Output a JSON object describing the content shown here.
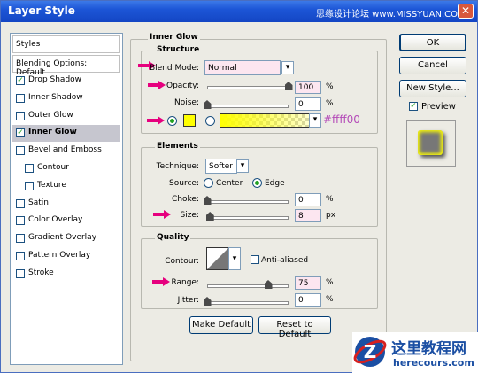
{
  "window": {
    "title": "Layer Style",
    "watermark": "思缘设计论坛 www.MISSYUAN.COM",
    "close_symbol": "✕"
  },
  "styles_panel": {
    "header": "Styles",
    "blending_default": "Blending Options: Default",
    "items": [
      {
        "label": "Drop Shadow",
        "checked": true,
        "selected": false,
        "sub": false
      },
      {
        "label": "Inner Shadow",
        "checked": false,
        "selected": false,
        "sub": false
      },
      {
        "label": "Outer Glow",
        "checked": false,
        "selected": false,
        "sub": false
      },
      {
        "label": "Inner Glow",
        "checked": true,
        "selected": true,
        "sub": false
      },
      {
        "label": "Bevel and Emboss",
        "checked": false,
        "selected": false,
        "sub": false
      },
      {
        "label": "Contour",
        "checked": false,
        "selected": false,
        "sub": true
      },
      {
        "label": "Texture",
        "checked": false,
        "selected": false,
        "sub": true
      },
      {
        "label": "Satin",
        "checked": false,
        "selected": false,
        "sub": false
      },
      {
        "label": "Color Overlay",
        "checked": false,
        "selected": false,
        "sub": false
      },
      {
        "label": "Gradient Overlay",
        "checked": false,
        "selected": false,
        "sub": false
      },
      {
        "label": "Pattern Overlay",
        "checked": false,
        "selected": false,
        "sub": false
      },
      {
        "label": "Stroke",
        "checked": false,
        "selected": false,
        "sub": false
      }
    ]
  },
  "inner_glow": {
    "title": "Inner Glow",
    "structure": {
      "title": "Structure",
      "blend_mode_label": "Blend Mode:",
      "blend_mode_value": "Normal",
      "opacity_label": "Opacity:",
      "opacity_value": "100",
      "opacity_level": 1.0,
      "noise_label": "Noise:",
      "noise_value": "0",
      "noise_level": 0.0,
      "percent": "%",
      "glow_color": "#ffff00",
      "color_annotation": "#ffff00"
    },
    "elements": {
      "title": "Elements",
      "technique_label": "Technique:",
      "technique_value": "Softer",
      "source_label": "Source:",
      "source_center": "Center",
      "source_edge": "Edge",
      "choke_label": "Choke:",
      "choke_value": "0",
      "choke_level": 0.0,
      "size_label": "Size:",
      "size_value": "8",
      "size_level": 0.035,
      "percent": "%",
      "px": "px"
    },
    "quality": {
      "title": "Quality",
      "contour_label": "Contour:",
      "anti_aliased_label": "Anti-aliased",
      "range_label": "Range:",
      "range_value": "75",
      "range_level": 0.75,
      "jitter_label": "Jitter:",
      "jitter_value": "0",
      "jitter_level": 0.0,
      "percent": "%"
    },
    "buttons": {
      "make_default": "Make Default",
      "reset_default": "Reset to Default"
    }
  },
  "right_panel": {
    "ok": "OK",
    "cancel": "Cancel",
    "new_style": "New Style...",
    "preview_label": "Preview",
    "preview_checked": true
  },
  "watermark_logo": {
    "brand": "这里教程网",
    "url": "herecours.com"
  },
  "colors": {
    "highlight_arrow": "#e6007e",
    "glow": "#ffff00"
  }
}
